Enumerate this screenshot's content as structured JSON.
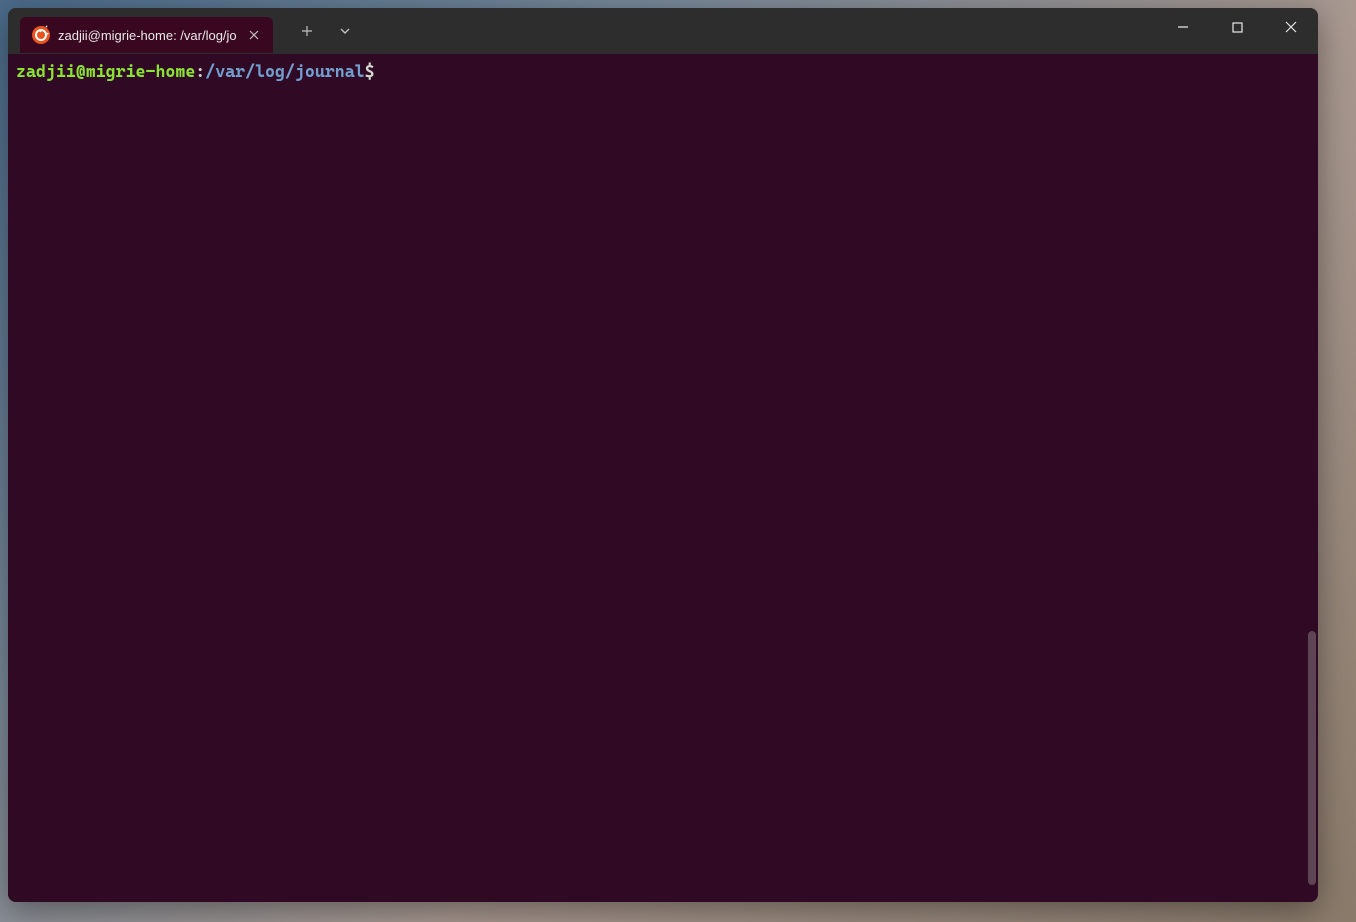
{
  "tab": {
    "title": "zadjii@migrie-home: /var/log/jo",
    "icon_name": "ubuntu-icon"
  },
  "prompt": {
    "user_host": "zadjii@migrie-home",
    "separator": ":",
    "path": "/var/log/journal",
    "symbol": "$"
  },
  "colors": {
    "terminal_bg": "#300a24",
    "titlebar_bg": "#2d2d2d",
    "prompt_user": "#8ae234",
    "prompt_path": "#729fcf",
    "prompt_text": "#d3d7cf",
    "ubuntu_orange": "#E95420"
  }
}
